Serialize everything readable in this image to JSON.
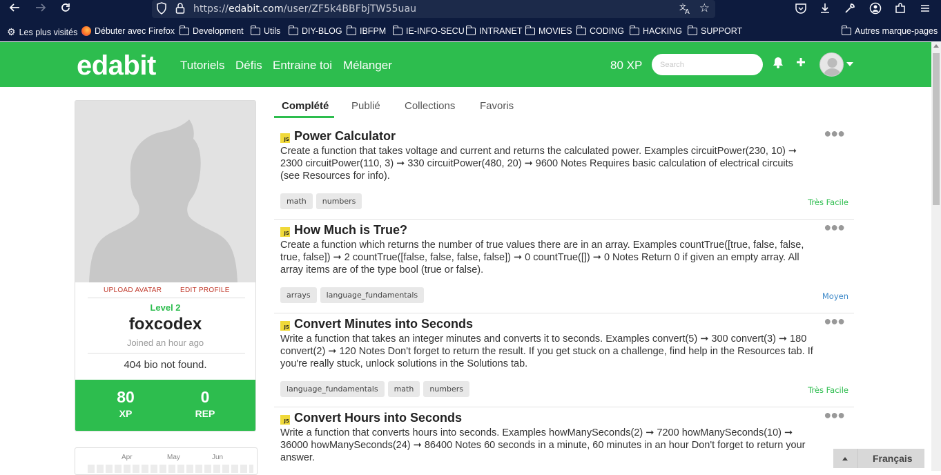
{
  "browser": {
    "url_prefix": "https://",
    "url_host": "edabit.com",
    "url_path": "/user/ZF5k4BBFbjTW55uau",
    "bookmarks": [
      "Les plus visités",
      "Débuter avec Firefox",
      "Development",
      "Utils",
      "DIY-BLOG",
      "IBFPM",
      "IE-INFO-SECU",
      "INTRANET",
      "MOVIES",
      "CODING",
      "HACKING",
      "SUPPORT"
    ],
    "other_bookmarks": "Autres marque-pages"
  },
  "header": {
    "logo": "edabit",
    "nav": [
      "Tutoriels",
      "Défis",
      "Entraine toi",
      "Mélanger"
    ],
    "xp": "80 XP",
    "search_placeholder": "Search"
  },
  "profile": {
    "upload_avatar": "UPLOAD AVATAR",
    "edit_profile": "EDIT PROFILE",
    "level": "Level 2",
    "username": "foxcodex",
    "joined": "Joined an hour ago",
    "bio": "404 bio not found.",
    "xp_value": "80",
    "xp_label": "XP",
    "rep_value": "0",
    "rep_label": "REP"
  },
  "calendar": {
    "months": [
      "Apr",
      "May",
      "Jun"
    ]
  },
  "tabs": [
    "Complété",
    "Publié",
    "Collections",
    "Favoris"
  ],
  "challenges": [
    {
      "icon_label": "JS",
      "title": "Power Calculator",
      "description": "Create a function that takes voltage and current and returns the calculated power. Examples circuitPower(230, 10) ➞ 2300 circuitPower(110, 3) ➞ 330 circuitPower(480, 20) ➞ 9600 Notes Requires basic calculation of electrical circuits (see Resources for info).",
      "tags": [
        "math",
        "numbers"
      ],
      "difficulty": "Très Facile",
      "difficulty_color": "#2dbd4e"
    },
    {
      "icon_label": "JS",
      "title": "How Much is True?",
      "description": "Create a function which returns the number of true values there are in an array. Examples countTrue([true, false, false, true, false]) ➞ 2 countTrue([false, false, false, false]) ➞ 0 countTrue([]) ➞ 0 Notes Return 0 if given an empty array. All array items are of the type bool (true or false).",
      "tags": [
        "arrays",
        "language_fundamentals"
      ],
      "difficulty": "Moyen",
      "difficulty_color": "#3a87c8"
    },
    {
      "icon_label": "JS",
      "title": "Convert Minutes into Seconds",
      "description": "Write a function that takes an integer minutes and converts it to seconds. Examples convert(5) ➞ 300 convert(3) ➞ 180 convert(2) ➞ 120 Notes Don't forget to return the result. If you get stuck on a challenge, find help in the Resources tab. If you're really stuck, unlock solutions in the Solutions tab.",
      "tags": [
        "language_fundamentals",
        "math",
        "numbers"
      ],
      "difficulty": "Très Facile",
      "difficulty_color": "#2dbd4e"
    },
    {
      "icon_label": "JS",
      "title": "Convert Hours into Seconds",
      "description": "Write a function that converts hours into seconds. Examples howManySeconds(2) ➞ 7200 howManySeconds(10) ➞ 36000 howManySeconds(24) ➞ 86400 Notes 60 seconds in a minute, 60 minutes in an hour Don't forget to return your answer.",
      "tags": [],
      "difficulty": "",
      "difficulty_color": "#2dbd4e"
    }
  ],
  "language": "Français",
  "colors": {
    "brand": "#2dbd4e",
    "chrome": "#0d1b3e",
    "danger": "#c0392b"
  }
}
